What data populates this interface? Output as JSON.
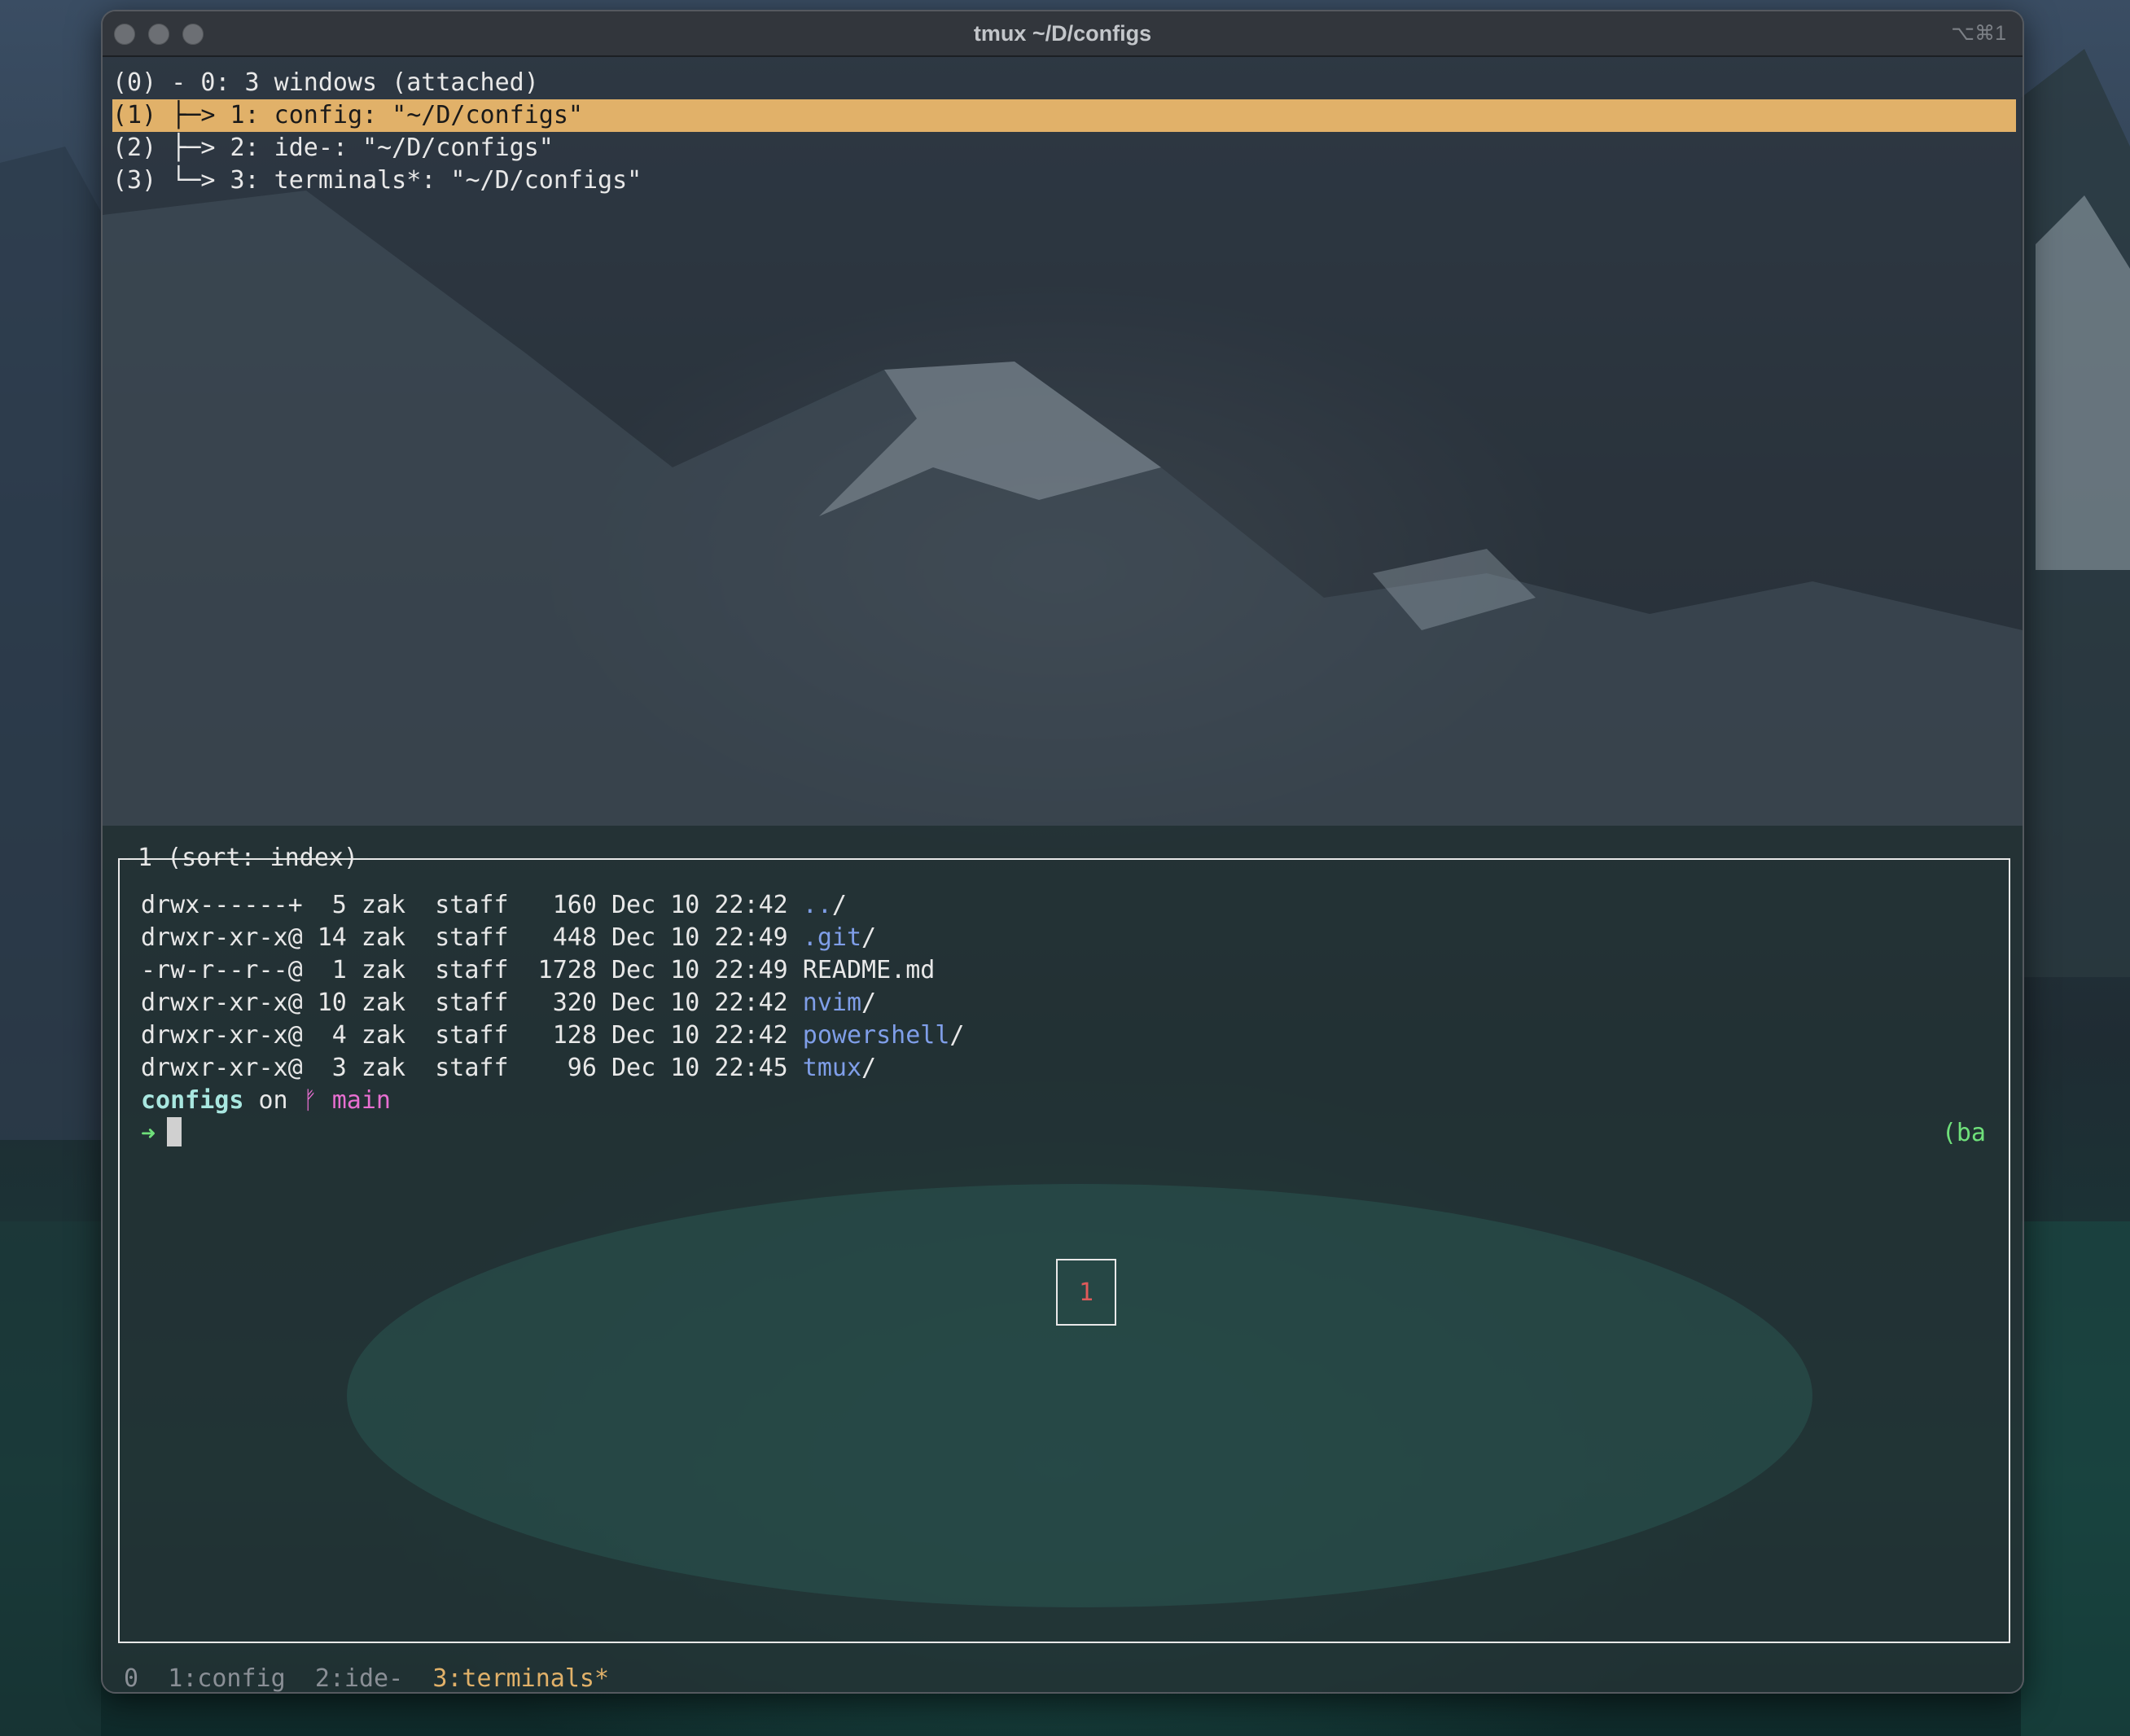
{
  "window": {
    "title": "tmux ~/D/configs",
    "shortcut": "⌥⌘1"
  },
  "tree": [
    {
      "text": "(0) - 0: 3 windows (attached)",
      "selected": false
    },
    {
      "text": "(1) ├─> 1: config: \"~/D/configs\"",
      "selected": true
    },
    {
      "text": "(2) ├─> 2: ide-: \"~/D/configs\"",
      "selected": false
    },
    {
      "text": "(3) └─> 3: terminals*: \"~/D/configs\"",
      "selected": false
    }
  ],
  "preview": {
    "title": "1 (sort: index)",
    "listing": [
      {
        "meta": "drwx------+  5 zak  staff   160 Dec 10 22:42 ",
        "name": "..",
        "suffix": "/",
        "is_dir": true
      },
      {
        "meta": "drwxr-xr-x@ 14 zak  staff   448 Dec 10 22:49 ",
        "name": ".git",
        "suffix": "/",
        "is_dir": true
      },
      {
        "meta": "-rw-r--r--@  1 zak  staff  1728 Dec 10 22:49 ",
        "name": "README.md",
        "suffix": "",
        "is_dir": false
      },
      {
        "meta": "drwxr-xr-x@ 10 zak  staff   320 Dec 10 22:42 ",
        "name": "nvim",
        "suffix": "/",
        "is_dir": true
      },
      {
        "meta": "drwxr-xr-x@  4 zak  staff   128 Dec 10 22:42 ",
        "name": "powershell",
        "suffix": "/",
        "is_dir": true
      },
      {
        "meta": "drwxr-xr-x@  3 zak  staff    96 Dec 10 22:45 ",
        "name": "tmux",
        "suffix": "/",
        "is_dir": true
      }
    ],
    "prompt": {
      "dir": "configs",
      "on": " on ",
      "branch_icon": "ᚠ",
      "branch": " main",
      "arrow": "➜"
    },
    "right_tag": "(ba",
    "pane_number": "1"
  },
  "status_bar": {
    "session": "0",
    "windows": [
      "1:config",
      "2:ide-",
      "3:terminals*"
    ],
    "current_index": 2
  },
  "colors": {
    "selection": "#e1b169",
    "dir": "#7f9ee8",
    "prompt_dir": "#a9e7e0",
    "branch": "#e86fd1",
    "arrow": "#6fe07a",
    "pane_number": "#e05a5a"
  }
}
